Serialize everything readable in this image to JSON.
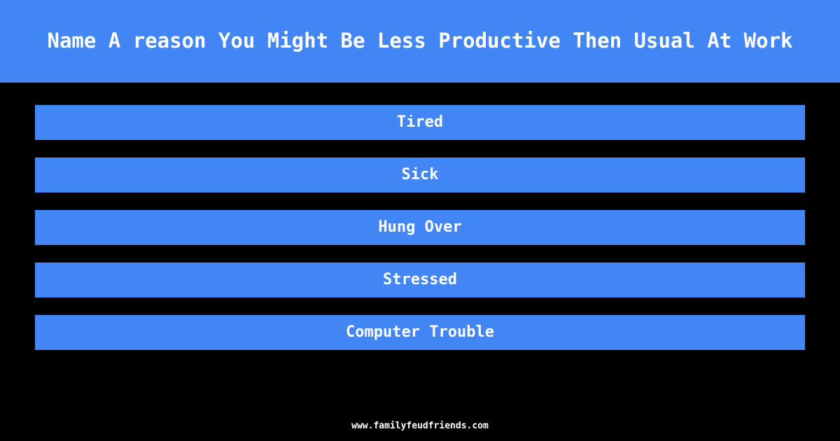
{
  "meta": {
    "background_color": "#000000",
    "accent_color": "#4285f4",
    "text_color": "#ffffff"
  },
  "header": {
    "question": "Name A reason You Might Be Less Productive Then Usual At Work"
  },
  "answers": {
    "items": [
      {
        "rank": 1,
        "label": "Tired"
      },
      {
        "rank": 2,
        "label": "Sick"
      },
      {
        "rank": 3,
        "label": "Hung Over"
      },
      {
        "rank": 4,
        "label": "Stressed"
      },
      {
        "rank": 5,
        "label": "Computer Trouble"
      }
    ]
  },
  "footer": {
    "url": "www.familyfeudfriends.com"
  }
}
